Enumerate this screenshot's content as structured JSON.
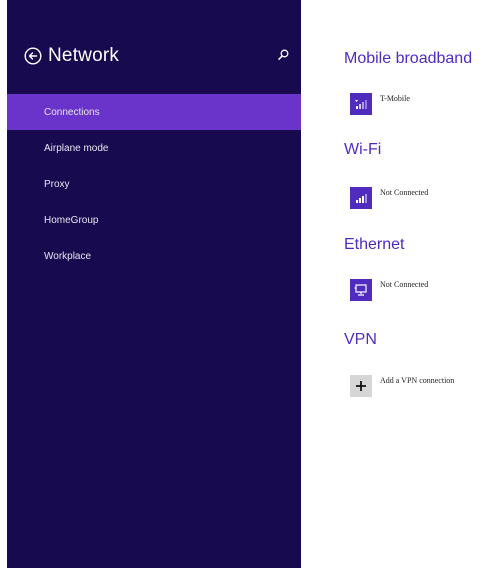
{
  "sidebar": {
    "title": "Network",
    "items": [
      {
        "label": "Connections",
        "selected": true
      },
      {
        "label": "Airplane mode",
        "selected": false
      },
      {
        "label": "Proxy",
        "selected": false
      },
      {
        "label": "HomeGroup",
        "selected": false
      },
      {
        "label": "Workplace",
        "selected": false
      }
    ]
  },
  "main": {
    "mobile_broadband": {
      "heading": "Mobile broadband",
      "connection": "T-Mobile",
      "icon": "signal-bars-icon"
    },
    "wifi": {
      "heading": "Wi-Fi",
      "connection": "Not Connected",
      "icon": "wifi-signal-icon"
    },
    "ethernet": {
      "heading": "Ethernet",
      "connection": "Not Connected",
      "icon": "ethernet-monitor-icon"
    },
    "vpn": {
      "heading": "VPN",
      "add_label": "Add a VPN connection",
      "icon": "plus-icon"
    }
  },
  "colors": {
    "sidebar_bg": "#180a4e",
    "selected_bg": "#6a33c9",
    "accent": "#4f2bc0"
  }
}
